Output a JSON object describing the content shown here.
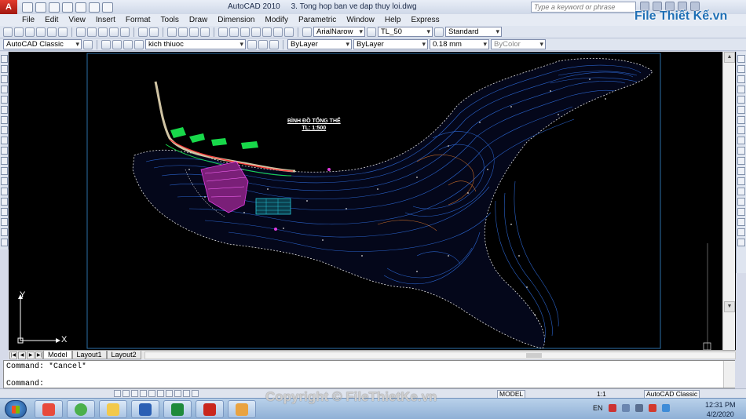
{
  "app": {
    "name": "AutoCAD 2010",
    "file_title": "3. Tong hop ban ve dap thuy loi.dwg",
    "search_placeholder": "Type a keyword or phrase"
  },
  "menu": [
    "File",
    "Edit",
    "View",
    "Insert",
    "Format",
    "Tools",
    "Draw",
    "Dimension",
    "Modify",
    "Parametric",
    "Window",
    "Help",
    "Express"
  ],
  "toolbar": {
    "text_style": "ArialNarow",
    "dim_style": "TL_50",
    "table_style": "Standard",
    "workspace": "AutoCAD Classic",
    "layer": "kich thiuoc",
    "color": "ByLayer",
    "linetype": "ByLayer",
    "lineweight": "0.18 mm",
    "plot_style": "ByColor"
  },
  "drawing": {
    "title_line1": "BÌNH ĐỒ TỔNG THỂ",
    "title_line2": "TL: 1:500",
    "ucs_x": "X",
    "ucs_y": "Y",
    "background": "#000000",
    "contour_color": "#2a62c9",
    "accent_colors": [
      "#e3a73a",
      "#18d84a",
      "#d93ad0",
      "#27c7d9",
      "#ff3030"
    ]
  },
  "layout_tabs": [
    "Model",
    "Layout1",
    "Layout2"
  ],
  "command": {
    "history": "Command: *Cancel*",
    "prompt": "Command:"
  },
  "status": {
    "space": "MODEL",
    "annotation_scale": "1:1",
    "workspace": "AutoCAD Classic"
  },
  "taskbar": {
    "language": "EN",
    "time": "12:31 PM",
    "date": "4/2/2020",
    "apps": [
      "windows-start",
      "unikey",
      "chrome-like",
      "file-explorer",
      "word",
      "excel",
      "autocad",
      "paint"
    ]
  },
  "watermark": {
    "logo": "File Thiết Kế.vn",
    "copyright": "Copyright © FileThietKe.vn"
  }
}
